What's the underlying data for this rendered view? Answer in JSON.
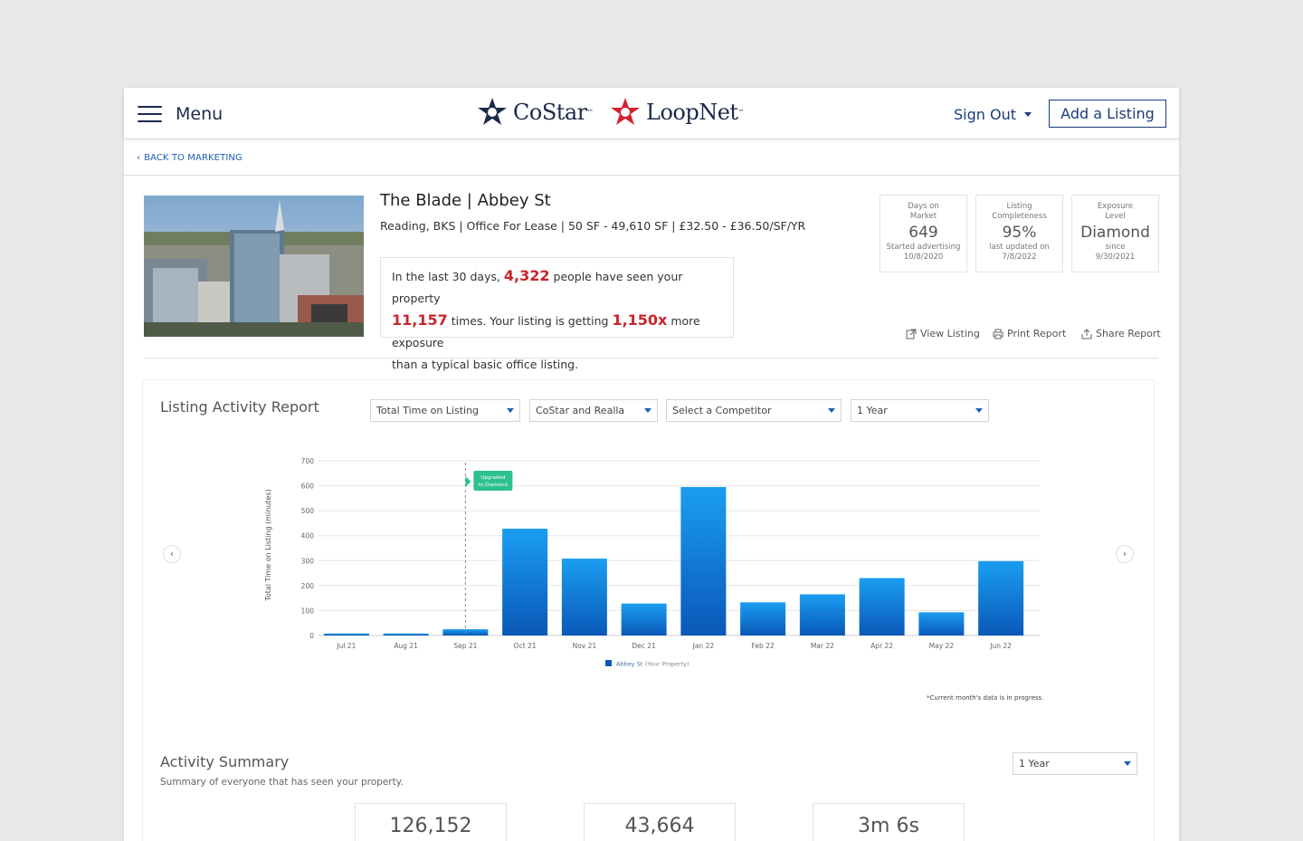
{
  "header": {
    "menu_label": "Menu",
    "costar_logo": "CoStar",
    "loopnet_logo": "LoopNet",
    "sign_out": "Sign Out",
    "add_listing": "Add a Listing"
  },
  "breadcrumb": {
    "back_label": "BACK TO MARKETING"
  },
  "property": {
    "title": "The Blade | Abbey St",
    "subtitle": "Reading, BKS | Office For Lease | 50 SF - 49,610 SF | £32.50 - £36.50/SF/YR",
    "exposure": {
      "p1": "In the last 30 days, ",
      "views": "4,322",
      "p2": " people have seen your property",
      "times": "11,157",
      "p3": " times. Your listing is getting ",
      "multiplier": "1,150x",
      "p4": " more exposure",
      "p5": "than a typical basic office listing."
    }
  },
  "stats": [
    {
      "label": "Days on Market",
      "value": "649",
      "sub1": "Started advertising",
      "sub2": "10/8/2020"
    },
    {
      "label": "Listing Completeness",
      "value": "95%",
      "sub1": "last updated on",
      "sub2": "7/8/2022"
    },
    {
      "label": "Exposure Level",
      "value": "Diamond",
      "sub1": "since",
      "sub2": "9/30/2021"
    }
  ],
  "actions": {
    "view_listing": "View Listing",
    "print_report": "Print Report",
    "share_report": "Share Report"
  },
  "report": {
    "title": "Listing Activity Report",
    "filters": {
      "metric": "Total Time on Listing",
      "sites": "CoStar and Realla",
      "competitor": "Select a Competitor",
      "period": "1 Year"
    },
    "footnote": "*Current month's data is in progress."
  },
  "chart_data": {
    "type": "bar",
    "categories": [
      "Jul 21",
      "Aug 21",
      "Sep 21",
      "Oct 21",
      "Nov 21",
      "Dec 21",
      "Jan 22",
      "Feb 22",
      "Mar 22",
      "Apr 22",
      "May 22",
      "Jun 22"
    ],
    "series": [
      {
        "name": "Abbey St",
        "name_suffix": "(Your Property)",
        "values": [
          8,
          8,
          25,
          428,
          308,
          128,
          595,
          133,
          165,
          230,
          93,
          298
        ]
      }
    ],
    "ylabel": "Total Time on Listing (minutes)",
    "ylim": [
      0,
      700
    ],
    "yticks": [
      0,
      100,
      200,
      300,
      400,
      500,
      600,
      700
    ],
    "grid": true,
    "legend_position": "bottom",
    "annotation": {
      "category": "Sep 21",
      "line1": "Upgraded",
      "line2": "to Diamond",
      "color": "#2ec08e"
    },
    "bar_color_top": "#1a9ef0",
    "bar_color_bottom": "#0a58b8"
  },
  "summary": {
    "title": "Activity Summary",
    "subtitle": "Summary of everyone that has seen your property.",
    "period": "1 Year",
    "cards": [
      "126,152",
      "43,664",
      "3m 6s"
    ]
  },
  "colors": {
    "brand_navy": "#1a2b4d",
    "link_blue": "#1a5fb4",
    "highlight_red": "#c8252c",
    "loopnet_red": "#d32030"
  }
}
